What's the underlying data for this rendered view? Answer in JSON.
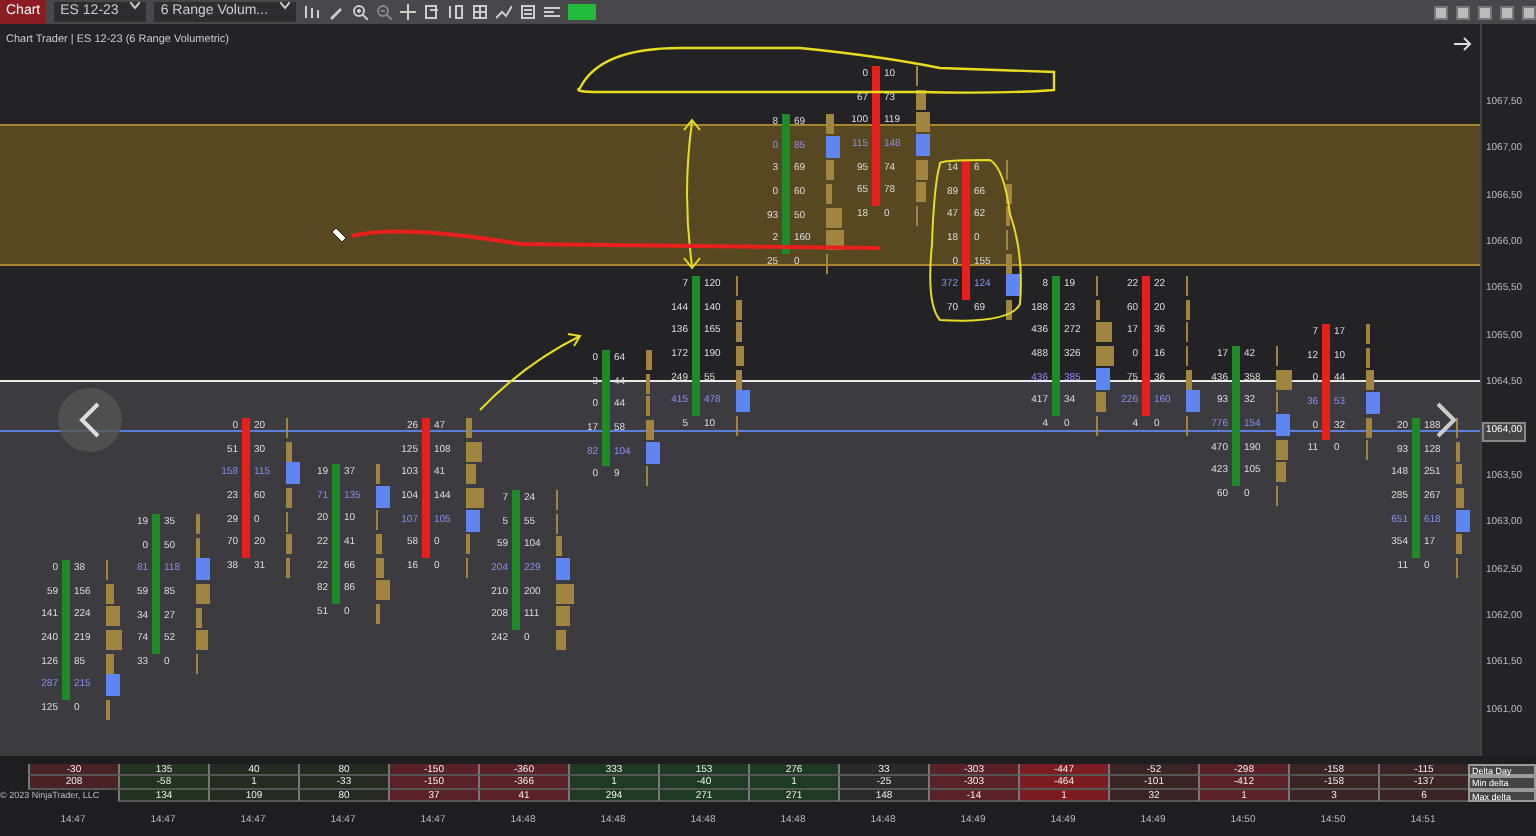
{
  "toolbar": {
    "chart_button": "Chart",
    "instrument": "ES 12-23",
    "chart_type": "6 Range Volum..."
  },
  "chart": {
    "title": "Chart Trader | ES 12-23 (6 Range Volumetric)",
    "copyright": "© 2023 NinjaTrader, LLC"
  },
  "price_axis": [
    {
      "label": "1067,50",
      "selected": false
    },
    {
      "label": "1067,00",
      "selected": false
    },
    {
      "label": "1066,50",
      "selected": false
    },
    {
      "label": "1066,00",
      "selected": false
    },
    {
      "label": "1065,50",
      "selected": false
    },
    {
      "label": "1065,00",
      "selected": false
    },
    {
      "label": "1064,50",
      "selected": false
    },
    {
      "label": "1064,00",
      "selected": true
    },
    {
      "label": "1063,50",
      "selected": false
    },
    {
      "label": "1063,00",
      "selected": false
    },
    {
      "label": "1062,50",
      "selected": false
    },
    {
      "label": "1062,00",
      "selected": false
    },
    {
      "label": "1061,50",
      "selected": false
    },
    {
      "label": "1061,00",
      "selected": false
    }
  ],
  "bars": [
    {
      "color": "#1f8a28",
      "rows": [
        {
          "bid": "0",
          "ask": "38",
          "poc": false
        },
        {
          "bid": "59",
          "ask": "156",
          "poc": false
        },
        {
          "bid": "141",
          "ask": "224",
          "poc": false
        },
        {
          "bid": "240",
          "ask": "219",
          "poc": false
        },
        {
          "bid": "126",
          "ask": "85",
          "poc": false
        },
        {
          "bid": "287",
          "ask": "215",
          "poc": true
        },
        {
          "bid": "125",
          "ask": "0",
          "poc": false
        }
      ]
    },
    {
      "color": "#1f8a28",
      "rows": [
        {
          "bid": "19",
          "ask": "35",
          "poc": false
        },
        {
          "bid": "0",
          "ask": "50",
          "poc": false
        },
        {
          "bid": "81",
          "ask": "118",
          "poc": true
        },
        {
          "bid": "59",
          "ask": "85",
          "poc": false
        },
        {
          "bid": "34",
          "ask": "27",
          "poc": false
        },
        {
          "bid": "74",
          "ask": "52",
          "poc": false
        },
        {
          "bid": "33",
          "ask": "0",
          "poc": false
        }
      ]
    },
    {
      "color": "#e8201c",
      "rows": [
        {
          "bid": "0",
          "ask": "20",
          "poc": false
        },
        {
          "bid": "51",
          "ask": "30",
          "poc": false
        },
        {
          "bid": "158",
          "ask": "115",
          "poc": true
        },
        {
          "bid": "23",
          "ask": "60",
          "poc": false
        },
        {
          "bid": "29",
          "ask": "0",
          "poc": false
        },
        {
          "bid": "70",
          "ask": "20",
          "poc": false
        },
        {
          "bid": "38",
          "ask": "31",
          "poc": false
        }
      ]
    },
    {
      "color": "#1f8a28",
      "rows": [
        {
          "bid": "19",
          "ask": "37",
          "poc": false
        },
        {
          "bid": "71",
          "ask": "135",
          "poc": true
        },
        {
          "bid": "20",
          "ask": "10",
          "poc": false
        },
        {
          "bid": "22",
          "ask": "41",
          "poc": false
        },
        {
          "bid": "22",
          "ask": "66",
          "poc": false
        },
        {
          "bid": "82",
          "ask": "86",
          "poc": false
        },
        {
          "bid": "51",
          "ask": "0",
          "poc": false
        }
      ]
    },
    {
      "color": "#e8201c",
      "rows": [
        {
          "bid": "26",
          "ask": "47",
          "poc": false
        },
        {
          "bid": "125",
          "ask": "108",
          "poc": false
        },
        {
          "bid": "103",
          "ask": "41",
          "poc": false
        },
        {
          "bid": "104",
          "ask": "144",
          "poc": false
        },
        {
          "bid": "107",
          "ask": "105",
          "poc": true
        },
        {
          "bid": "58",
          "ask": "0",
          "poc": false
        },
        {
          "bid": "16",
          "ask": "0",
          "poc": false
        }
      ]
    },
    {
      "color": "#1f8a28",
      "rows": [
        {
          "bid": "7",
          "ask": "24",
          "poc": false
        },
        {
          "bid": "5",
          "ask": "55",
          "poc": false
        },
        {
          "bid": "59",
          "ask": "104",
          "poc": false
        },
        {
          "bid": "204",
          "ask": "229",
          "poc": true
        },
        {
          "bid": "210",
          "ask": "200",
          "poc": false
        },
        {
          "bid": "208",
          "ask": "111",
          "poc": false
        },
        {
          "bid": "242",
          "ask": "0",
          "poc": false
        }
      ]
    },
    {
      "color": "#1f8a28",
      "rows": [
        {
          "bid": "0",
          "ask": "64",
          "poc": false
        },
        {
          "bid": "3",
          "ask": "44",
          "poc": false
        },
        {
          "bid": "0",
          "ask": "44",
          "poc": false
        },
        {
          "bid": "17",
          "ask": "58",
          "poc": false
        },
        {
          "bid": "82",
          "ask": "104",
          "poc": true
        },
        {
          "bid": "0",
          "ask": "9",
          "poc": false
        }
      ]
    },
    {
      "color": "#1f8a28",
      "rows": [
        {
          "bid": "7",
          "ask": "120",
          "poc": false
        },
        {
          "bid": "144",
          "ask": "140",
          "poc": false
        },
        {
          "bid": "136",
          "ask": "165",
          "poc": false
        },
        {
          "bid": "172",
          "ask": "190",
          "poc": false
        },
        {
          "bid": "249",
          "ask": "55",
          "poc": false
        },
        {
          "bid": "415",
          "ask": "478",
          "poc": true
        },
        {
          "bid": "5",
          "ask": "10",
          "poc": false
        }
      ]
    },
    {
      "color": "#1f8a28",
      "rows": [
        {
          "bid": "8",
          "ask": "69",
          "poc": false
        },
        {
          "bid": "0",
          "ask": "85",
          "poc": true
        },
        {
          "bid": "3",
          "ask": "69",
          "poc": false
        },
        {
          "bid": "0",
          "ask": "60",
          "poc": false
        },
        {
          "bid": "93",
          "ask": "50",
          "poc": false
        },
        {
          "bid": "2",
          "ask": "160",
          "poc": false
        },
        {
          "bid": "25",
          "ask": "0",
          "poc": false
        }
      ]
    },
    {
      "color": "#e8201c",
      "rows": [
        {
          "bid": "0",
          "ask": "10",
          "poc": false
        },
        {
          "bid": "67",
          "ask": "73",
          "poc": false
        },
        {
          "bid": "100",
          "ask": "119",
          "poc": false
        },
        {
          "bid": "115",
          "ask": "148",
          "poc": true
        },
        {
          "bid": "95",
          "ask": "74",
          "poc": false
        },
        {
          "bid": "65",
          "ask": "78",
          "poc": false
        },
        {
          "bid": "18",
          "ask": "0",
          "poc": false
        }
      ]
    },
    {
      "color": "#e8201c",
      "rows": [
        {
          "bid": "14",
          "ask": "6",
          "poc": false
        },
        {
          "bid": "89",
          "ask": "66",
          "poc": false
        },
        {
          "bid": "47",
          "ask": "62",
          "poc": false
        },
        {
          "bid": "18",
          "ask": "0",
          "poc": false
        },
        {
          "bid": "0",
          "ask": "155",
          "poc": false
        },
        {
          "bid": "372",
          "ask": "124",
          "poc": true
        },
        {
          "bid": "70",
          "ask": "69",
          "poc": false
        }
      ]
    },
    {
      "color": "#1f8a28",
      "rows": [
        {
          "bid": "8",
          "ask": "19",
          "poc": false
        },
        {
          "bid": "188",
          "ask": "23",
          "poc": false
        },
        {
          "bid": "436",
          "ask": "272",
          "poc": false
        },
        {
          "bid": "488",
          "ask": "326",
          "poc": false
        },
        {
          "bid": "436",
          "ask": "385",
          "poc": true
        },
        {
          "bid": "417",
          "ask": "34",
          "poc": false
        },
        {
          "bid": "4",
          "ask": "0",
          "poc": false
        }
      ]
    },
    {
      "color": "#e8201c",
      "rows": [
        {
          "bid": "22",
          "ask": "22",
          "poc": false
        },
        {
          "bid": "60",
          "ask": "20",
          "poc": false
        },
        {
          "bid": "17",
          "ask": "36",
          "poc": false
        },
        {
          "bid": "0",
          "ask": "16",
          "poc": false
        },
        {
          "bid": "75",
          "ask": "36",
          "poc": false
        },
        {
          "bid": "226",
          "ask": "160",
          "poc": true
        },
        {
          "bid": "4",
          "ask": "0",
          "poc": false
        }
      ]
    },
    {
      "color": "#1f8a28",
      "rows": [
        {
          "bid": "17",
          "ask": "42",
          "poc": false
        },
        {
          "bid": "436",
          "ask": "358",
          "poc": false
        },
        {
          "bid": "93",
          "ask": "32",
          "poc": false
        },
        {
          "bid": "776",
          "ask": "154",
          "poc": true
        },
        {
          "bid": "470",
          "ask": "190",
          "poc": false
        },
        {
          "bid": "423",
          "ask": "105",
          "poc": false
        },
        {
          "bid": "60",
          "ask": "0",
          "poc": false
        }
      ]
    },
    {
      "color": "#e8201c",
      "rows": [
        {
          "bid": "7",
          "ask": "17",
          "poc": false
        },
        {
          "bid": "12",
          "ask": "10",
          "poc": false
        },
        {
          "bid": "0",
          "ask": "44",
          "poc": false
        },
        {
          "bid": "36",
          "ask": "53",
          "poc": true
        },
        {
          "bid": "0",
          "ask": "32",
          "poc": false
        },
        {
          "bid": "11",
          "ask": "0",
          "poc": false
        }
      ]
    },
    {
      "color": "#1f8a28",
      "rows": [
        {
          "bid": "20",
          "ask": "188",
          "poc": false
        },
        {
          "bid": "93",
          "ask": "128",
          "poc": false
        },
        {
          "bid": "148",
          "ask": "251",
          "poc": false
        },
        {
          "bid": "285",
          "ask": "267",
          "poc": false
        },
        {
          "bid": "651",
          "ask": "618",
          "poc": true
        },
        {
          "bid": "354",
          "ask": "17",
          "poc": false
        },
        {
          "bid": "11",
          "ask": "0",
          "poc": false
        }
      ]
    }
  ],
  "table": {
    "row_labels": [
      "Delta Day",
      "Min delta",
      "Max delta"
    ],
    "columns": [
      {
        "color": "#4a2226",
        "cells": [
          "-30",
          "208"
        ]
      },
      {
        "color": "#22331f",
        "cells": [
          "135",
          "-58",
          "134"
        ]
      },
      {
        "color": "#262a22",
        "cells": [
          "40",
          "1",
          "109"
        ]
      },
      {
        "color": "#262a22",
        "cells": [
          "80",
          "-33",
          "80"
        ]
      },
      {
        "color": "#5a2226",
        "cells": [
          "-150",
          "-150",
          "37"
        ]
      },
      {
        "color": "#5a2226",
        "cells": [
          "-360",
          "-366",
          "41"
        ]
      },
      {
        "color": "#1f3a22",
        "cells": [
          "333",
          "1",
          "294"
        ]
      },
      {
        "color": "#1f3a22",
        "cells": [
          "153",
          "-40",
          "271"
        ]
      },
      {
        "color": "#1f3a22",
        "cells": [
          "276",
          "1",
          "271"
        ]
      },
      {
        "color": "#2a2a2a",
        "cells": [
          "33",
          "-25",
          "148"
        ]
      },
      {
        "color": "#5a2226",
        "cells": [
          "-303",
          "-303",
          "-14"
        ]
      },
      {
        "color": "#7a1c20",
        "cells": [
          "-447",
          "-464",
          "1"
        ]
      },
      {
        "color": "#3a2426",
        "cells": [
          "-52",
          "-101",
          "32"
        ]
      },
      {
        "color": "#5a2226",
        "cells": [
          "-298",
          "-412",
          "1"
        ]
      },
      {
        "color": "#3a2426",
        "cells": [
          "-158",
          "-158",
          "3"
        ]
      },
      {
        "color": "#3a2426",
        "cells": [
          "-115",
          "-137",
          "6"
        ]
      }
    ]
  },
  "times": [
    "14:47",
    "14:47",
    "14:47",
    "14:47",
    "14:47",
    "14:48",
    "14:48",
    "14:48",
    "14:48",
    "14:48",
    "14:49",
    "14:49",
    "14:49",
    "14:50",
    "14:50",
    "14:51"
  ]
}
